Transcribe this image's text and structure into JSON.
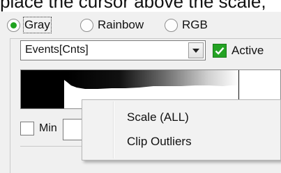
{
  "caption_fragment": "place the cursor above the scale,",
  "color_mode": {
    "options": [
      {
        "label": "Gray",
        "selected": true
      },
      {
        "label": "Rainbow",
        "selected": false
      },
      {
        "label": "RGB",
        "selected": false
      }
    ]
  },
  "channel_select": {
    "value": "Events[Cnts]"
  },
  "active_checkbox": {
    "label": "Active",
    "checked": true
  },
  "min_checkbox": {
    "label": "Min",
    "checked": false
  },
  "context_menu": {
    "items": [
      {
        "label": "Scale (ALL)"
      },
      {
        "label": "Clip Outliers"
      }
    ]
  },
  "colors": {
    "radio_selected": "#1fa31f",
    "checkbox_checked": "#24a324",
    "panel_bg": "#f0f0f0",
    "menu_bg": "#f2f2f2"
  }
}
